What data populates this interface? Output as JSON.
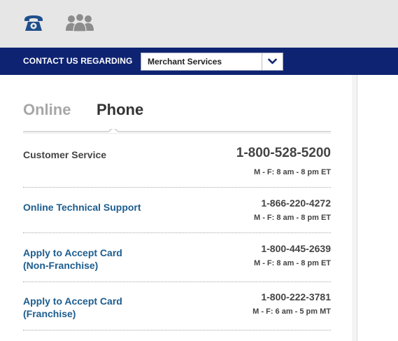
{
  "header": {
    "icons": [
      "phone-icon",
      "people-icon"
    ],
    "contact_label": "CONTACT US REGARDING",
    "selected_topic": "Merchant Services"
  },
  "tabs": [
    {
      "label": "Online",
      "active": false
    },
    {
      "label": "Phone",
      "active": true
    }
  ],
  "contacts": [
    {
      "label": "Customer Service",
      "number": "1-800-528-5200",
      "hours": "M - F: 8 am - 8 pm ET"
    },
    {
      "label": "Online Technical Support",
      "number": "1-866-220-4272",
      "hours": "M - F: 8 am - 8 pm ET"
    },
    {
      "label": "Apply to Accept Card\n(Non-Franchise)",
      "number": "1-800-445-2639",
      "hours": "M - F: 8 am - 8 pm ET"
    },
    {
      "label": "Apply to Accept Card\n(Franchise)",
      "number": "1-800-222-3781",
      "hours": "M - F: 6 am - 5 pm MT"
    }
  ],
  "colors": {
    "nav_bar": "#0e2372",
    "icon_blue": "#1f4e8c",
    "link": "#1c5d8f",
    "top_bar": "#e6e6e6"
  }
}
